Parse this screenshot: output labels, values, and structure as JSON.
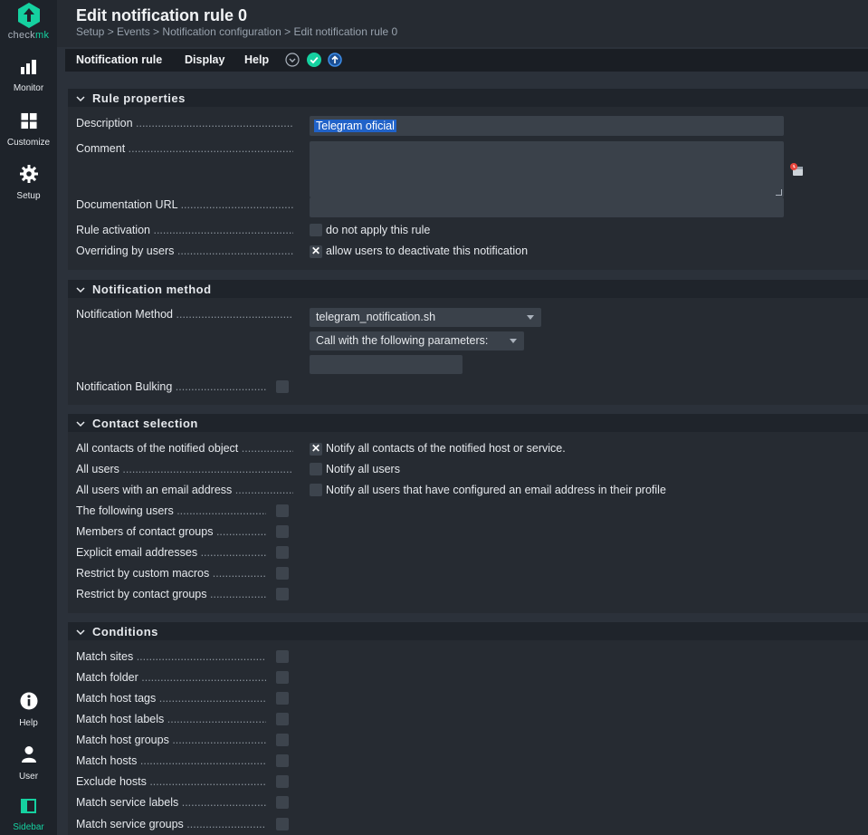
{
  "sidebar": {
    "logo_text_a": "check",
    "logo_text_b": "mk",
    "items": [
      {
        "label": "Monitor",
        "icon": "monitor-icon"
      },
      {
        "label": "Customize",
        "icon": "customize-icon"
      },
      {
        "label": "Setup",
        "icon": "gear-icon"
      }
    ],
    "bottom_items": [
      {
        "label": "Help",
        "icon": "info-icon"
      },
      {
        "label": "User",
        "icon": "user-icon"
      },
      {
        "label": "Sidebar",
        "icon": "sidebar-icon"
      }
    ]
  },
  "header": {
    "title": "Edit notification rule 0",
    "breadcrumb": "Setup > Events > Notification configuration > Edit notification rule 0"
  },
  "menubar": {
    "items": [
      "Notification rule",
      "Display",
      "Help"
    ],
    "icons": [
      "chevron-down-circle-icon",
      "save-check-icon",
      "upload-icon"
    ]
  },
  "sections": {
    "rule_properties": {
      "title": "Rule properties",
      "description_label": "Description",
      "description_value": "Telegram oficial",
      "comment_label": "Comment",
      "comment_value": "",
      "documentation_label": "Documentation URL",
      "documentation_value": "",
      "activation_label": "Rule activation",
      "activation_text": "do not apply this rule",
      "activation_checked": false,
      "overriding_label": "Overriding by users",
      "overriding_text": "allow users to deactivate this notification",
      "overriding_checked": true
    },
    "notification_method": {
      "title": "Notification method",
      "method_label": "Notification Method",
      "method_value": "telegram_notification.sh",
      "param_mode": "Call with the following parameters:",
      "param_value": "",
      "bulking_label": "Notification Bulking",
      "bulking_checked": false
    },
    "contact_selection": {
      "title": "Contact selection",
      "rows": [
        {
          "label": "All contacts of the notified object",
          "text": "Notify all contacts of the notified host or service.",
          "checked": true
        },
        {
          "label": "All users",
          "text": "Notify all users",
          "checked": false
        },
        {
          "label": "All users with an email address",
          "text": "Notify all users that have configured an email address in their profile",
          "checked": false
        },
        {
          "label": "The following users",
          "text": "",
          "checked": false
        },
        {
          "label": "Members of contact groups",
          "text": "",
          "checked": false
        },
        {
          "label": "Explicit email addresses",
          "text": "",
          "checked": false
        },
        {
          "label": "Restrict by custom macros",
          "text": "",
          "checked": false
        },
        {
          "label": "Restrict by contact groups",
          "text": "",
          "checked": false
        }
      ]
    },
    "conditions": {
      "title": "Conditions",
      "rows": [
        {
          "label": "Match sites",
          "checked": false
        },
        {
          "label": "Match folder",
          "checked": false
        },
        {
          "label": "Match host tags",
          "checked": false
        },
        {
          "label": "Match host labels",
          "checked": false
        },
        {
          "label": "Match host groups",
          "checked": false
        },
        {
          "label": "Match hosts",
          "checked": false
        },
        {
          "label": "Exclude hosts",
          "checked": false
        },
        {
          "label": "Match service labels",
          "checked": false
        },
        {
          "label": "Match service groups",
          "checked": false
        }
      ]
    }
  },
  "colors": {
    "accent": "#15d1a0",
    "background": "#2b313a",
    "sidebar": "#1e232a",
    "selection": "#2062c8"
  }
}
